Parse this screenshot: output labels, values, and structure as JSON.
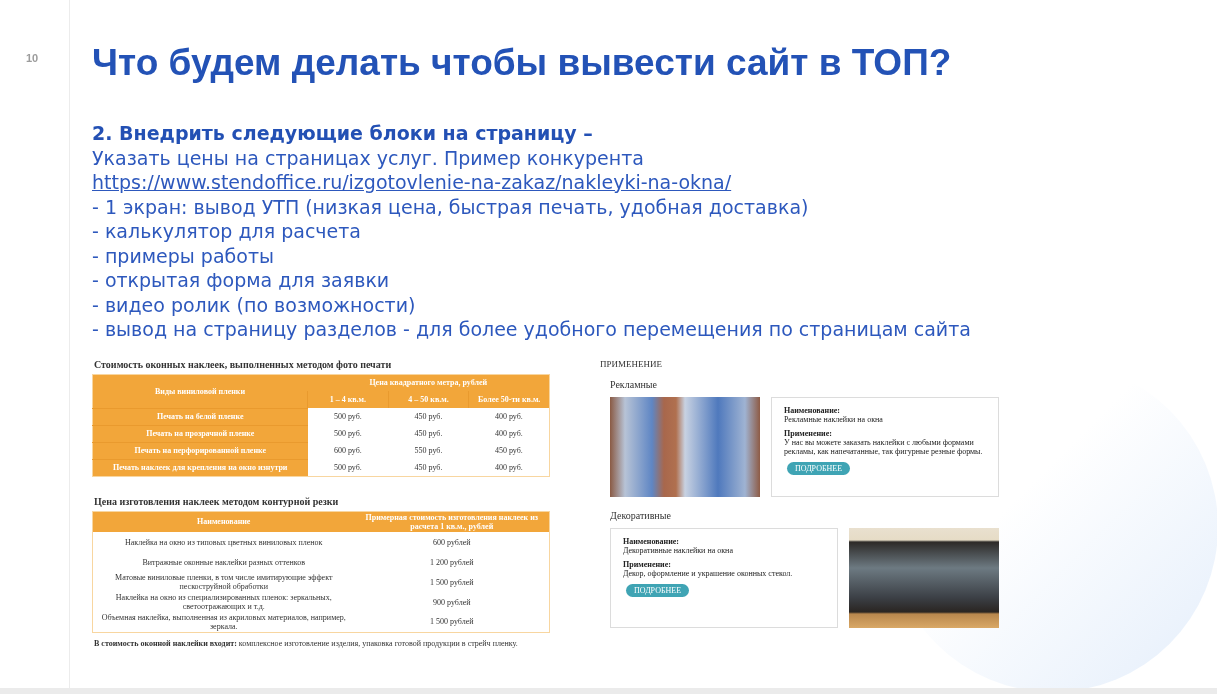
{
  "slide": {
    "number": "10",
    "title": "Что будем делать чтобы вывести сайт в ТОП?"
  },
  "section": {
    "heading": "2. Внедрить следующие блоки на страницу –",
    "intro": "Указать цены на страницах услуг. Пример конкурента",
    "link": "https://www.stendoffice.ru/izgotovlenie-na-zakaz/nakleyki-na-okna/"
  },
  "bullets": [
    "- 1 экран: вывод УТП (низкая цена, быстрая печать, удобная доставка)",
    "- калькулятор для расчета",
    "- примеры работы",
    "- открытая форма для заявки",
    "- видео ролик (по возможности)",
    "- вывод на страницу разделов - для более удобного перемещения по страницам сайта"
  ],
  "price_screenshot": {
    "photo_print_table": {
      "title": "Стоимость оконных наклеек, выполненных методом фото печати",
      "label_header": "Виды виниловой пленки",
      "group_header": "Цена квадратного метра, рублей",
      "columns": [
        "1 – 4 кв.м.",
        "4 – 50 кв.м.",
        "Более 50-ти кв.м."
      ],
      "rows": [
        {
          "label": "Печать на белой пленке",
          "prices": [
            "500 руб.",
            "450 руб.",
            "400 руб."
          ]
        },
        {
          "label": "Печать на прозрачной пленке",
          "prices": [
            "500 руб.",
            "450 руб.",
            "400 руб."
          ]
        },
        {
          "label": "Печать на перфорированной пленке",
          "prices": [
            "600 руб.",
            "550 руб.",
            "450 руб."
          ]
        },
        {
          "label": "Печать наклеек для крепления на окно изнутри",
          "prices": [
            "500 руб.",
            "450 руб.",
            "400 руб."
          ]
        }
      ]
    },
    "contour_table": {
      "title": "Цена изготовления наклеек методом контурной резки",
      "columns": [
        "Наименование",
        "Примерная стоимость изготовления наклеек из расчета 1 кв.м., рублей"
      ],
      "rows": [
        {
          "name": "Наклейка на окно из типовых цветных виниловых пленок",
          "price": "600 рублей"
        },
        {
          "name": "Витражные оконные наклейки разных оттенков",
          "price": "1 200 рублей"
        },
        {
          "name": "Матовые виниловые пленки, в том числе имитирующие эффект пескоструйной обработки",
          "price": "1 500 рублей"
        },
        {
          "name": "Наклейка на окно из специализированных пленок: зеркальных, светоотражающих и т.д.",
          "price": "900 рублей"
        },
        {
          "name": "Объемная наклейка, выполненная из акриловых материалов, например, зеркала.",
          "price": "1 500 рублей"
        }
      ]
    },
    "footnote": "**В стоимость оконной наклейки входит:** комплексное изготовление изделия, упаковка готовой продукции в стрейч пленку."
  },
  "usage_screenshot": {
    "heading": "ПРИМЕНЕНИЕ",
    "blocks": [
      {
        "title": "Рекламные",
        "name_label": "Наименование:",
        "name": "Рекламные наклейки на окна",
        "usage_label": "Применение:",
        "usage": "У нас вы можете заказать наклейки с любыми формами рекламы, как напечатанные, так фигурные резные формы.",
        "button": "ПОДРОБНЕЕ"
      },
      {
        "title": "Декоративные",
        "name_label": "Наименование:",
        "name": "Декоративные наклейки на окна",
        "usage_label": "Применение:",
        "usage": "Декор, оформление и украшение оконных стекол.",
        "button": "ПОДРОБНЕЕ"
      }
    ]
  }
}
